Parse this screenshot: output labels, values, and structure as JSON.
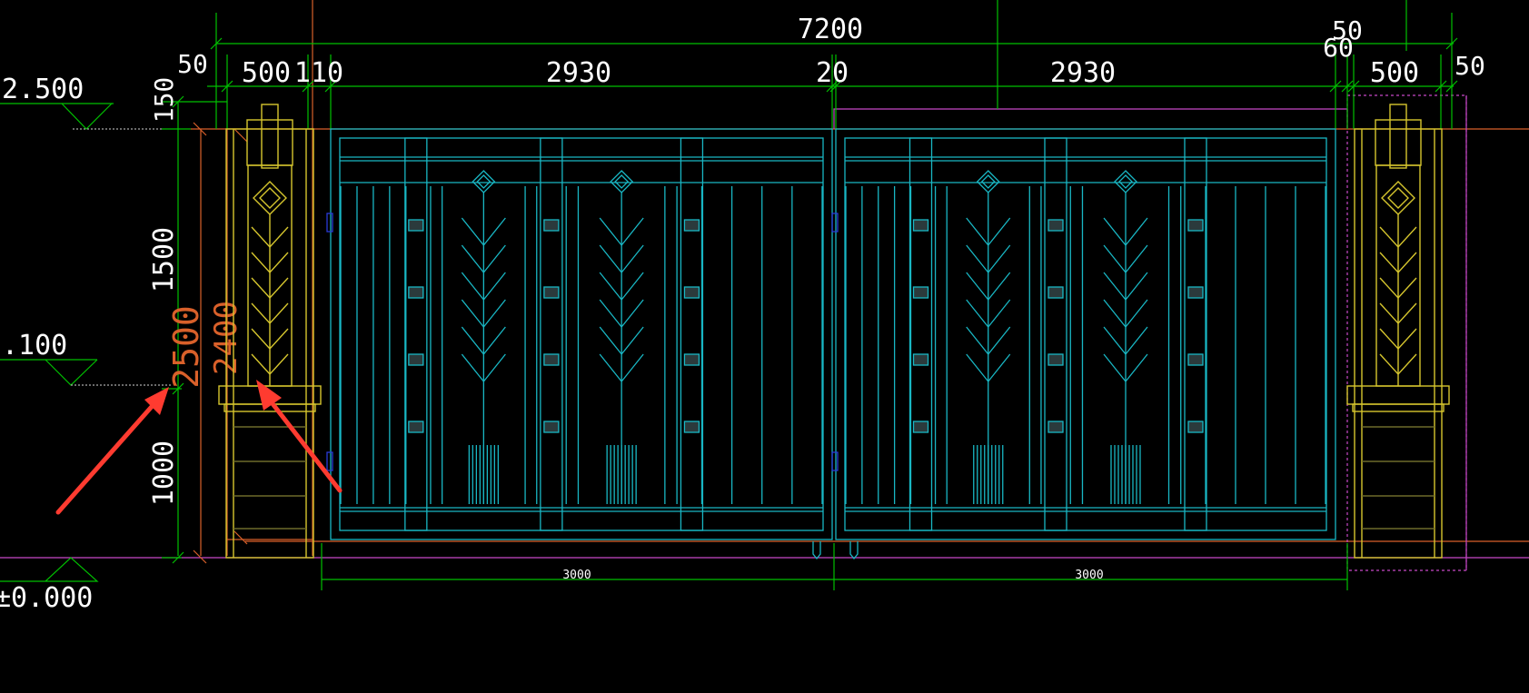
{
  "drawing": {
    "top_overall_dim": "7200",
    "top_dims": {
      "left_offset": "50",
      "left_pillar": "500",
      "left_gap": "110",
      "left_leaf": "2930",
      "center_gap": "20",
      "right_leaf": "2930",
      "right_gap": "60",
      "right_offset": "50",
      "right_pillar": "500",
      "right_edge": "50"
    },
    "left_dims": {
      "top_cap": "150",
      "upper": "1500",
      "lower": "1000",
      "overall": "2500",
      "inner": "2400"
    },
    "bottom_dims": {
      "left_span": "3000",
      "right_span": "3000"
    },
    "elevations": {
      "top": "2.500",
      "mid": ".100",
      "ground": "±0.000"
    }
  },
  "colors": {
    "background": "#000000",
    "dimension": "#00c000",
    "gate": "#19b7c4",
    "pillar": "#d6c62e",
    "reference": "#c848c8",
    "orange_line": "#d9602a",
    "arrow": "#ff3b30",
    "text": "#ffffff"
  }
}
